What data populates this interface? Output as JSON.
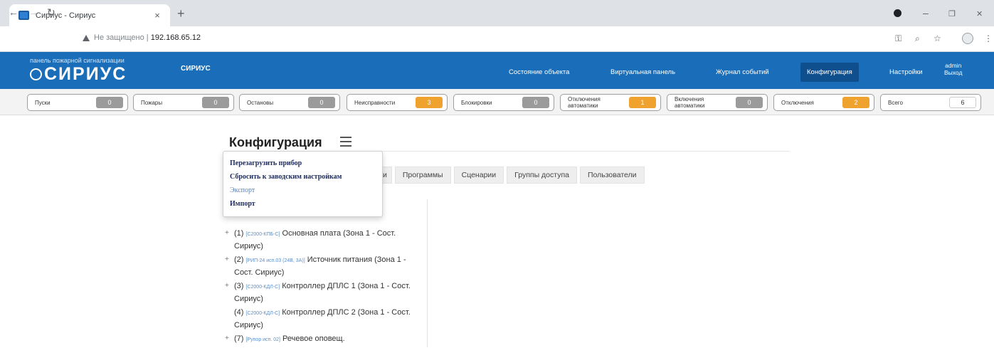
{
  "browser": {
    "tab_title": "Сириус - Сириус",
    "tab_close": "×",
    "new_tab": "+",
    "address_security": "Не защищено",
    "address_separator": "|",
    "address_host": "192.168.65.12",
    "window_controls": [
      "–",
      "❐",
      "✕"
    ]
  },
  "header": {
    "brand_subtitle": "панель пожарной сигнализации",
    "brand_name": "СИРИУС",
    "object_name": "СИРИУС",
    "nav": [
      {
        "label": "Состояние объекта",
        "active": false
      },
      {
        "label": "Виртуальная панель",
        "active": false
      },
      {
        "label": "Журнал событий",
        "active": false
      },
      {
        "label": "Конфигурация",
        "active": true
      },
      {
        "label": "Настройки",
        "active": false
      }
    ],
    "admin_user": "admin",
    "logout": "Выход"
  },
  "counters": [
    {
      "label": "Пуски",
      "value": "0",
      "color": "#9b9b9b"
    },
    {
      "label": "Пожары",
      "value": "0",
      "color": "#9b9b9b"
    },
    {
      "label": "Остановы",
      "value": "0",
      "color": "#9b9b9b"
    },
    {
      "label": "Неисправности",
      "value": "3",
      "color": "#f0a22e"
    },
    {
      "label": "Блокировки",
      "value": "0",
      "color": "#9b9b9b"
    },
    {
      "label": "Отключения автоматики",
      "value": "1",
      "color": "#f0a22e"
    },
    {
      "label": "Включения автоматики",
      "value": "0",
      "color": "#9b9b9b"
    },
    {
      "label": "Отключения",
      "value": "2",
      "color": "#f0a22e"
    },
    {
      "label": "Всего",
      "value": "6",
      "color": "#ffffff"
    }
  ],
  "page": {
    "title": "Конфигурация",
    "menu": [
      "Перезагрузить прибор",
      "Сбросить к заводским настройкам",
      "Экспорт",
      "Импорт"
    ],
    "tabs": [
      "и",
      "Программы",
      "Сценарии",
      "Группы доступа",
      "Пользователи"
    ],
    "tree": [
      {
        "toggle": "+",
        "num": "(1)",
        "code": "[С2000-КПБ-С]",
        "name": "Основная плата (Зона 1 - Сост. Сириус)"
      },
      {
        "toggle": "+",
        "num": "(2)",
        "code": "[РИП-24 исп.03 (24В, 3А)]",
        "name": "Источник питания (Зона 1 - Сост. Сириус)"
      },
      {
        "toggle": "+",
        "num": "(3)",
        "code": "[С2000-КДЛ-С]",
        "name": "Контроллер ДПЛС 1 (Зона 1 - Сост. Сириус)"
      },
      {
        "toggle": "",
        "num": "(4)",
        "code": "[С2000-КДЛ-С]",
        "name": "Контроллер ДПЛС 2 (Зона 1 - Сост. Сириус)"
      },
      {
        "toggle": "+",
        "num": "(7)",
        "code": "[Рупор исп. 02]",
        "name": "Речевое оповещ."
      }
    ]
  }
}
